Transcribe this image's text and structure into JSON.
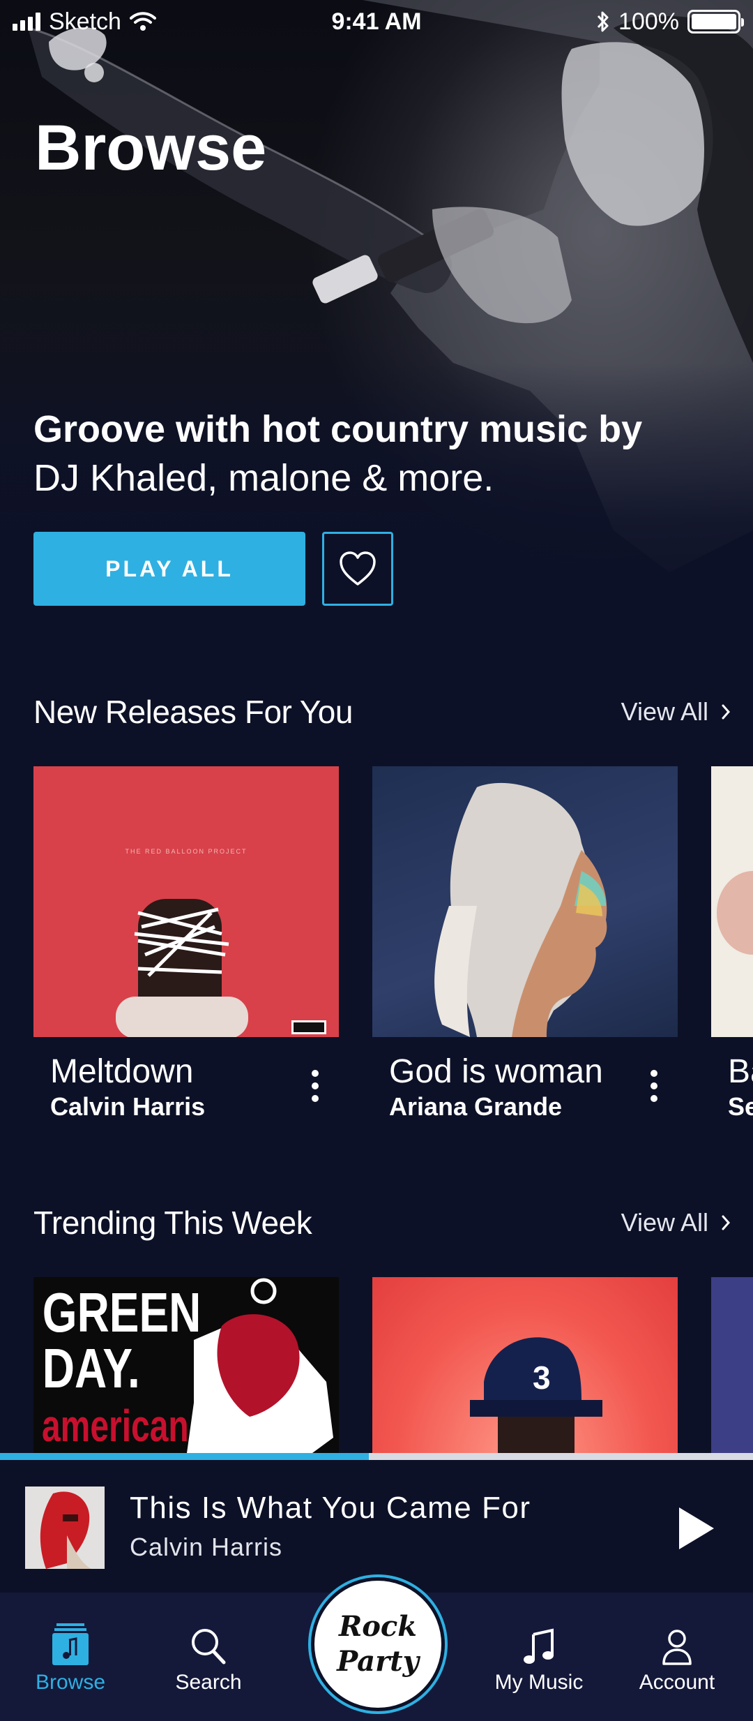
{
  "status_bar": {
    "carrier": "Sketch",
    "time": "9:41 AM",
    "battery": "100%"
  },
  "page": {
    "title": "Browse"
  },
  "hero": {
    "headline_bold": "Groove with hot country music by",
    "headline_regular": "DJ Khaled, malone & more.",
    "play_all_label": "PLAY ALL",
    "favorite_icon": "heart-icon"
  },
  "new_releases": {
    "title": "New Releases For You",
    "view_all_label": "View All",
    "items": [
      {
        "title": "Meltdown",
        "artist": "Calvin Harris"
      },
      {
        "title": "God is woman",
        "artist": "Ariana Grande"
      },
      {
        "title": "Ba",
        "artist": "Se"
      }
    ]
  },
  "trending": {
    "title": "Trending This Week",
    "view_all_label": "View All"
  },
  "now_playing": {
    "title": "This Is What You Came For",
    "artist": "Calvin Harris",
    "progress_percent": 49
  },
  "tab_bar": {
    "tabs": [
      {
        "label": "Browse",
        "icon": "music-note-square-icon",
        "active": true
      },
      {
        "label": "Search",
        "icon": "search-icon",
        "active": false
      },
      {
        "label": "My Music",
        "icon": "music-note-icon",
        "active": false
      },
      {
        "label": "Account",
        "icon": "person-icon",
        "active": false
      }
    ],
    "center": {
      "line1": "Rock",
      "line2": "Party"
    }
  },
  "colors": {
    "background": "#0d1127",
    "accent": "#2fb0e2",
    "tab_bar": "#14193a"
  }
}
